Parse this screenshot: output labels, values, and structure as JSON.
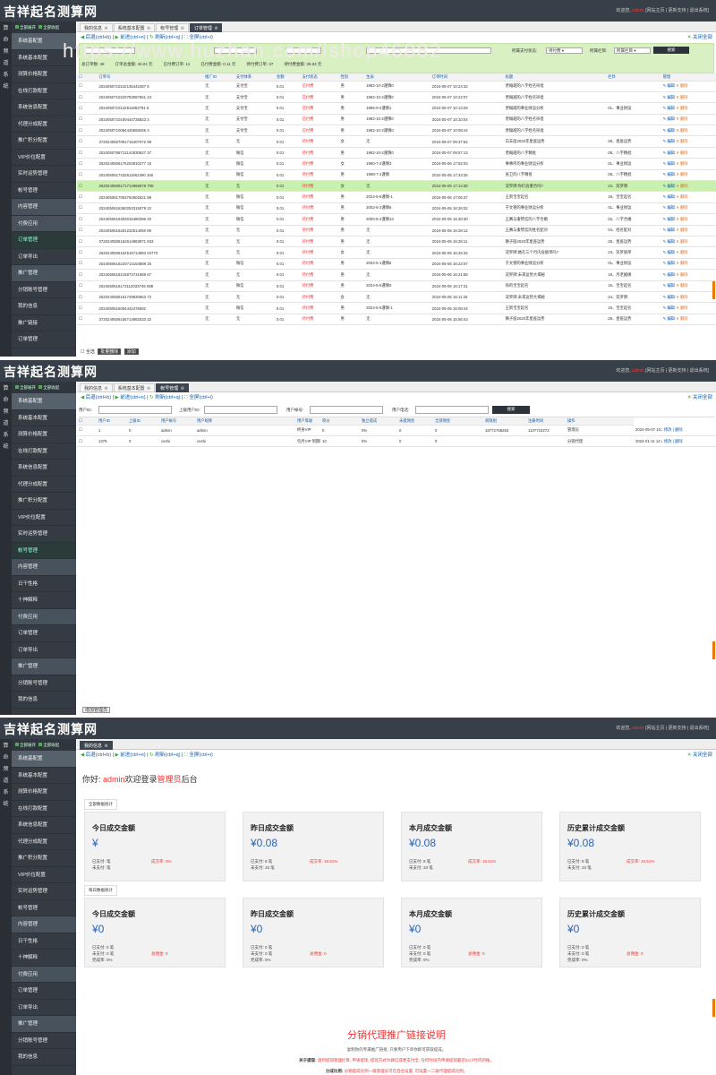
{
  "app": {
    "title": "吉祥起名测算网",
    "welcome": "欢迎您,",
    "user": "admin",
    "links": "[网站主页 | 更新支持 | 退出系统]",
    "sidehead_a": "全部展开",
    "sidehead_b": "全部收起"
  },
  "leftcol": [
    "算",
    "命",
    "频",
    "道",
    "系",
    "统"
  ],
  "watermark": "https://www.huzhan.com/ishop46882",
  "nav": {
    "back": "后退(ctrl+b)",
    "forward": "前进(ctrl+n)",
    "refresh": "刷新(ctrl+q)",
    "fullscreen": "全屏(ctrl+i)",
    "close_all": "关闭全部"
  },
  "sidebar1": [
    {
      "label": "系统基配置",
      "type": "grp"
    },
    {
      "label": "系统基本配置",
      "type": ""
    },
    {
      "label": "测算价格配置",
      "type": ""
    },
    {
      "label": "在线打款配置",
      "type": ""
    },
    {
      "label": "系统信息配置",
      "type": ""
    },
    {
      "label": "代理分成配置",
      "type": ""
    },
    {
      "label": "推广积分配置",
      "type": ""
    },
    {
      "label": "VIP价位配置",
      "type": ""
    },
    {
      "label": "实时运势管理",
      "type": ""
    },
    {
      "label": "帐号管理",
      "type": ""
    },
    {
      "label": "内容管理",
      "type": "sec"
    },
    {
      "label": "付费应用",
      "type": "sec"
    },
    {
      "label": "订单管理",
      "type": "act"
    },
    {
      "label": "订单导出",
      "type": ""
    },
    {
      "label": "推广管理",
      "type": "sec"
    },
    {
      "label": "分销账号管理",
      "type": ""
    },
    {
      "label": "我的信息",
      "type": ""
    },
    {
      "label": "推广链接",
      "type": ""
    },
    {
      "label": "订单管理",
      "type": ""
    }
  ],
  "sidebar2": [
    {
      "label": "系统基配置",
      "type": "grp"
    },
    {
      "label": "系统基本配置",
      "type": ""
    },
    {
      "label": "测算价格配置",
      "type": ""
    },
    {
      "label": "在线打款配置",
      "type": ""
    },
    {
      "label": "系统信息配置",
      "type": ""
    },
    {
      "label": "代理分成配置",
      "type": ""
    },
    {
      "label": "推广积分配置",
      "type": ""
    },
    {
      "label": "VIP价位配置",
      "type": ""
    },
    {
      "label": "实时运势管理",
      "type": ""
    },
    {
      "label": "帐号管理",
      "type": "act"
    },
    {
      "label": "内容管理",
      "type": "sec"
    },
    {
      "label": "日干性格",
      "type": ""
    },
    {
      "label": "十神解释",
      "type": ""
    },
    {
      "label": "付费应用",
      "type": "sec"
    },
    {
      "label": "订单管理",
      "type": ""
    },
    {
      "label": "订单导出",
      "type": ""
    },
    {
      "label": "推广管理",
      "type": "sec"
    },
    {
      "label": "分销账号管理",
      "type": ""
    },
    {
      "label": "我的信息",
      "type": ""
    }
  ],
  "sidebar3": [
    {
      "label": "系统基配置",
      "type": "grp"
    },
    {
      "label": "系统基本配置",
      "type": ""
    },
    {
      "label": "测算价格配置",
      "type": ""
    },
    {
      "label": "在线打款配置",
      "type": ""
    },
    {
      "label": "系统信息配置",
      "type": ""
    },
    {
      "label": "代理分成配置",
      "type": ""
    },
    {
      "label": "推广积分配置",
      "type": ""
    },
    {
      "label": "VIP价位配置",
      "type": ""
    },
    {
      "label": "实时运势管理",
      "type": ""
    },
    {
      "label": "帐号管理",
      "type": ""
    },
    {
      "label": "内容管理",
      "type": "sec"
    },
    {
      "label": "日干性格",
      "type": ""
    },
    {
      "label": "十神解释",
      "type": ""
    },
    {
      "label": "付费应用",
      "type": "sec"
    },
    {
      "label": "订单管理",
      "type": ""
    },
    {
      "label": "订单导出",
      "type": ""
    },
    {
      "label": "推广管理",
      "type": "sec"
    },
    {
      "label": "分销账号管理",
      "type": ""
    },
    {
      "label": "我的信息",
      "type": ""
    }
  ],
  "tabs1": [
    "我的信息",
    "系统基本配置",
    "帐号管理",
    "订单管理"
  ],
  "tabs2": [
    "我的信息",
    "系统基本配置",
    "帐号管理"
  ],
  "tabs3": [
    "我的信息"
  ],
  "orders": {
    "filter": {
      "status_label": "所属支付状态:",
      "status_value": "待付费",
      "cat_label": "所属栏目:",
      "cat_value": "所属栏目",
      "search": "搜索"
    },
    "stats": [
      "总订单数: 48",
      "订单总金额: 40.04 元",
      "已付费订单: 11",
      "已付费金额: 0.11 元",
      "待付费订单: 37",
      "待付费金额: 39.93 元"
    ],
    "columns": [
      "订单号",
      "推广ID",
      "支付体系",
      "金额",
      "支付状态",
      "性别",
      "生辰",
      "订单时间",
      "标题",
      "栏目",
      "管理"
    ],
    "rows": [
      [
        "2024050710242135442487 6",
        "无",
        "支付宝",
        "0.01",
        "已付费",
        "男",
        "1982-10-2谨慎0",
        "2024-05-07 10:24:32",
        "贾翰越的八字姓名祥批",
        "",
        "编辑 删除"
      ],
      [
        "2024050710220783087651 24",
        "无",
        "支付宝",
        "0.01",
        "已付费",
        "男",
        "1982-10-2谨慎0",
        "2024-05-07 10:22:07",
        "贾翰越的八字姓名祥批",
        "",
        ""
      ],
      [
        "2024050710132911892781 6",
        "无",
        "支付宝",
        "0.01",
        "已付费",
        "男",
        "1996-9-2谨慎1",
        "2024-05-07 10:13:29",
        "贾翰越的事业财运分析",
        "01、事业财运",
        ""
      ],
      [
        "2024050710100444735823 3",
        "无",
        "支付宝",
        "0.01",
        "已付费",
        "男",
        "1982-10-2谨慎0",
        "2024-05-07 10:10:04",
        "贾翰越的八字姓名祥批",
        "",
        ""
      ],
      [
        "2024050710084445559265 3",
        "无",
        "支付宝",
        "0.01",
        "已付费",
        "男",
        "1982-10-2谨慎0",
        "2024-05-07 10:08:44",
        "贾翰越的八字姓名祥批",
        "",
        ""
      ],
      [
        "3720240507091715407072 99",
        "无",
        "无",
        "0.01",
        "待付费",
        "女",
        "无",
        "2024-05-07 09:37:52",
        "白羊座2020年星座运势",
        "28、星座运势",
        ""
      ],
      [
        "2024050795713142830827 37",
        "无",
        "微信",
        "0.01",
        "待付费",
        "男",
        "1982-10-2谨慎0",
        "2024-05-07 09:57:13",
        "贾翰越的八字精批",
        "08、八字精批",
        ""
      ],
      [
        "2620240506175203910277 15",
        "无",
        "微信",
        "0.01",
        "待付费",
        "女",
        "1990-7-2谨慎3",
        "2024-05-06 17:52:03",
        "事事所的事业财运分析",
        "01、事业财运",
        ""
      ],
      [
        "2024050617432611662490 160",
        "无",
        "微信",
        "0.01",
        "待付费",
        "男",
        "1998-7-1谨慎",
        "2024-05-06 17:43:26",
        "张卫的八字精批",
        "08、八字精批",
        ""
      ],
      [
        "2620240506171714966878 709",
        "无",
        "无",
        "0.01",
        "待付费",
        "女",
        "无",
        "2024-05-06 17:14:38",
        "双罗牌:你们会重合吗?",
        "24、双罗牌",
        ""
      ],
      [
        "2024050617063782602521 98",
        "无",
        "微信",
        "0.01",
        "待付费",
        "男",
        "2024-5-6谨慎-1",
        "2024-05-06 17:06:37",
        "王新宝宝起名",
        "16、宝宝起名",
        ""
      ],
      [
        "2024050616360253315079 22",
        "无",
        "微信",
        "0.01",
        "待付费",
        "男",
        "2002-6-2谨慎6",
        "2024-05-06 16:26:02",
        "于文德的事业财运分析",
        "01、事业财运",
        ""
      ],
      [
        "2024050616303016480396 20",
        "无",
        "微信",
        "0.01",
        "待付费",
        "男",
        "2000-8-2谨慎13",
        "2024-05-06 16:30:30",
        "王赛与秦赞宏的八字合婚",
        "02、八字合婚",
        ""
      ],
      [
        "2024050616281232514050 89",
        "无",
        "无",
        "0.01",
        "待付费",
        "男",
        "无",
        "2024-05-06 16:28:12",
        "王赛与秦赞宏的姓名配对",
        "04、姓名配对",
        ""
      ],
      [
        "3720240506162614983971 833",
        "无",
        "无",
        "0.01",
        "待付费",
        "男",
        "无",
        "2024-05-06 16:26:11",
        "狮子座2020年星座运势",
        "28、星座运势",
        ""
      ],
      [
        "2620240506162516714983 04770",
        "无",
        "无",
        "0.01",
        "待付费",
        "女",
        "无",
        "2024-05-06 16:25:34",
        "双罗牌:她在三个月内会脱单吗?",
        "23、双罗脱单",
        ""
      ],
      [
        "2024050616220714153889 25",
        "无",
        "微信",
        "0.01",
        "待付费",
        "男",
        "2002-5-1谨慎6",
        "2024-05-06 16:22:07",
        "于文德的事业财运分析",
        "01、事业财运",
        ""
      ],
      [
        "2024050616215874731888 67",
        "无",
        "无",
        "0.01",
        "待付费",
        "男",
        "无",
        "2024-05-06 16:21:58",
        "双罗牌:未来运势大揭秘",
        "18、月老姻缘",
        ""
      ],
      [
        "2024050616173112033746 088",
        "无",
        "微信",
        "0.01",
        "待付费",
        "男",
        "2024-5-6谨慎0",
        "2024-05-06 16:17:31",
        "徐的宝宝起名",
        "16、宝宝起名",
        ""
      ],
      [
        "2620240506161749830653 72",
        "无",
        "无",
        "0.01",
        "待付费",
        "女",
        "无",
        "2024-05-06 16:11:25",
        "双罗牌:未来运势大揭秘",
        "24、双罗牌",
        ""
      ],
      [
        "2024050616084442476692",
        "无",
        "微信",
        "0.01",
        "待付费",
        "男",
        "2024-5-6谨慎-1",
        "2024-05-06 16:08:44",
        "王新宝宝起名",
        "16、宝宝起名",
        ""
      ],
      [
        "3720240506155714982033 32",
        "无",
        "无",
        "0.01",
        "待付费",
        "男",
        "无",
        "2024-05-06 15:56:43",
        "狮子座2020年星座运势",
        "28、星座运势",
        ""
      ]
    ],
    "footer": {
      "select_all": "全选",
      "batch_delete": "批量删除",
      "add": "添加"
    },
    "op_edit": "编辑",
    "op_del": "删除"
  },
  "users": {
    "filter": {
      "uid": "用户ID:",
      "puid": "上级用户ID:",
      "account": "用户帐号:",
      "phone": "用户电话:",
      "search": "搜索"
    },
    "columns": [
      "用户ID",
      "上级ID",
      "用户帐号",
      "用户昵称",
      "用户等级",
      "积分",
      "独立提成",
      "未提佣金",
      "全部佣金",
      "权限组",
      "注册时间",
      "操作"
    ],
    "rows": [
      [
        "1",
        "0",
        "admin",
        "admin",
        "终身VIP",
        "0",
        "0%",
        "0",
        "0",
        "18772768263",
        "1107710272",
        "管理员",
        "2024-05-07 10:26:11",
        "修改 | 删除"
      ],
      [
        "1376",
        "0",
        "ceshi",
        "ceshi",
        "包月VIP 到期时间: 2024-02-11",
        "10",
        "0%",
        "0",
        "0",
        "",
        "",
        "分销代理",
        "2024-01-11 14:42:26",
        "修改 | 删除"
      ]
    ],
    "add_btn": "增加管理员"
  },
  "info": {
    "greet_pre": "你好: ",
    "greet_user": "admin",
    "greet_mid": "欢迎登录",
    "greet_role": "管理员",
    "greet_post": "后台",
    "sec_all": "全部数据统计",
    "sec_daily": "每日数据统计",
    "cards_all": [
      {
        "title": "今日成交金额",
        "value": "¥",
        "paid": "已支付: 笔",
        "unpaid": "未支付: 笔",
        "rate": "成交率: 0%"
      },
      {
        "title": "昨日成交金额",
        "value": "¥0.08",
        "paid": "已支付: 8 笔",
        "unpaid": "未支付: 33 笔",
        "rate": "成交率: 19.51%"
      },
      {
        "title": "本月成交金额",
        "value": "¥0.08",
        "paid": "已支付: 8 笔",
        "unpaid": "未支付: 33 笔",
        "rate": "成交率: 19.51%"
      },
      {
        "title": "历史累计成交金额",
        "value": "¥0.08",
        "paid": "已支付: 8 笔",
        "unpaid": "未支付: 33 笔",
        "rate": "成交率: 19.51%"
      }
    ],
    "cards_daily": [
      {
        "title": "今日成交金额",
        "value": "¥0",
        "paid": "已支付: 0 笔",
        "unpaid": "未支付: 0 笔",
        "done": "完成率: 0%",
        "total": "总佣金: 0"
      },
      {
        "title": "昨日成交金额",
        "value": "¥0",
        "paid": "已支付: 0 笔",
        "unpaid": "未支付: 0 笔",
        "done": "完成率: 0%",
        "total": "总佣金: 0"
      },
      {
        "title": "本月成交金额",
        "value": "¥0",
        "paid": "已支付: 0 笔",
        "unpaid": "未支付: 0 笔",
        "done": "完成率: 0%",
        "total": "总佣金: 0"
      },
      {
        "title": "历史累计成交金额",
        "value": "¥0",
        "paid": "已支付: 0 笔",
        "unpaid": "未支付: 0 笔",
        "done": "完成率: 0%",
        "total": "总佣金: 0"
      }
    ],
    "promo_title": "分销代理推广链接说明",
    "promo_sub": "复制你的专属推广链接, 只要用户下单你即可获取提成。",
    "promo_n1_label": "关于提现: ",
    "promo_n1": "请到提现管理栏目, 申请提现, 提现方式为微信或者支付宝, 任何时间内申请提现最迟24小时内到账。",
    "promo_n2_label": "分成比例: ",
    "promo_n2": "分销提成比例一级管理员可在后台设置, 可设置一二级代理提成比例。"
  },
  "colors": {
    "topbar": "#373f48",
    "sidebar": "#343b42",
    "accent": "#0a5db0",
    "red": "#e33",
    "filter_bg": "#d9f0c3",
    "highlight": "#c9f0ae",
    "scroll": "#e8790b"
  }
}
